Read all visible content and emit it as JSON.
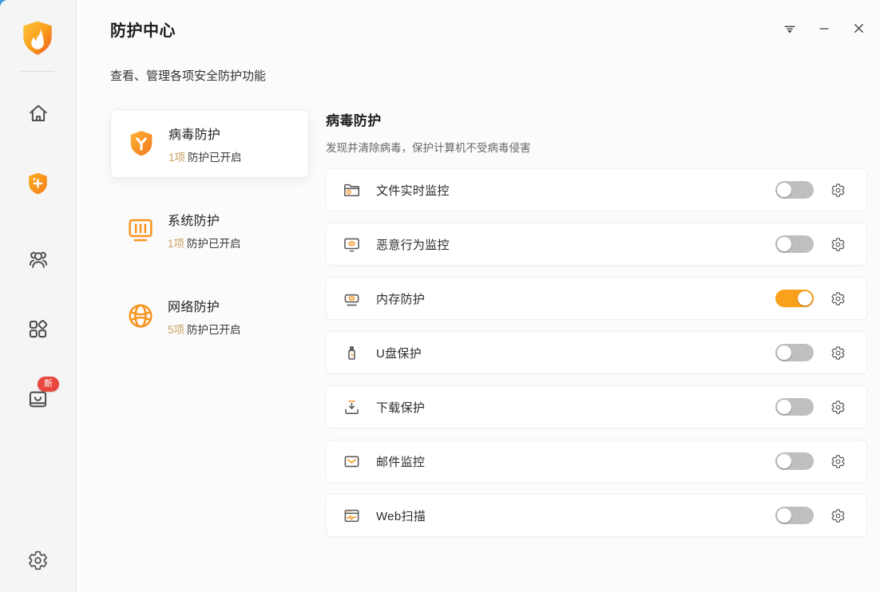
{
  "header": {
    "title": "防护中心",
    "subtitle": "查看、管理各项安全防护功能"
  },
  "window_controls": [
    {
      "icon": "main-menu-icon"
    },
    {
      "icon": "minimize-icon"
    },
    {
      "icon": "close-icon"
    }
  ],
  "sidebar": {
    "items": [
      {
        "icon": "app-logo"
      },
      {
        "icon": "home-icon"
      },
      {
        "icon": "shield-plus-icon",
        "active": true
      },
      {
        "icon": "users-icon"
      },
      {
        "icon": "apps-icon"
      },
      {
        "icon": "toolbox-icon",
        "badge": "新"
      },
      {
        "icon": "sidebar-gear-icon"
      }
    ]
  },
  "categories": [
    {
      "icon": "virus-protection-icon",
      "name": "病毒防护",
      "count": "1项",
      "status": "防护已开启",
      "selected": true
    },
    {
      "icon": "system-protection-icon",
      "name": "系统防护",
      "count": "1项",
      "status": "防护已开启",
      "selected": false
    },
    {
      "icon": "network-protection-icon",
      "name": "网络防护",
      "count": "5项",
      "status": "防护已开启",
      "selected": false
    }
  ],
  "panel": {
    "title": "病毒防护",
    "description": "发现并清除病毒，保护计算机不受病毒侵害",
    "rows": [
      {
        "icon": "file-monitor-icon",
        "label": "文件实时监控",
        "enabled": false
      },
      {
        "icon": "behavior-monitor-icon",
        "label": "恶意行为监控",
        "enabled": false
      },
      {
        "icon": "memory-protect-icon",
        "label": "内存防护",
        "enabled": true
      },
      {
        "icon": "usb-protect-icon",
        "label": "U盘保护",
        "enabled": false
      },
      {
        "icon": "download-protect-icon",
        "label": "下载保护",
        "enabled": false
      },
      {
        "icon": "mail-monitor-icon",
        "label": "邮件监控",
        "enabled": false
      },
      {
        "icon": "web-scan-icon",
        "label": "Web扫描",
        "enabled": false
      }
    ]
  },
  "colors": {
    "accent_orange": "#f7941e",
    "toggle_on": "#f9a11b",
    "toggle_off": "#bfbfbf",
    "badge_red": "#e8473f",
    "count_gold": "#c9a05e",
    "sidebar_bg": "#f5f5f6",
    "main_bg": "#fbfbfc"
  }
}
